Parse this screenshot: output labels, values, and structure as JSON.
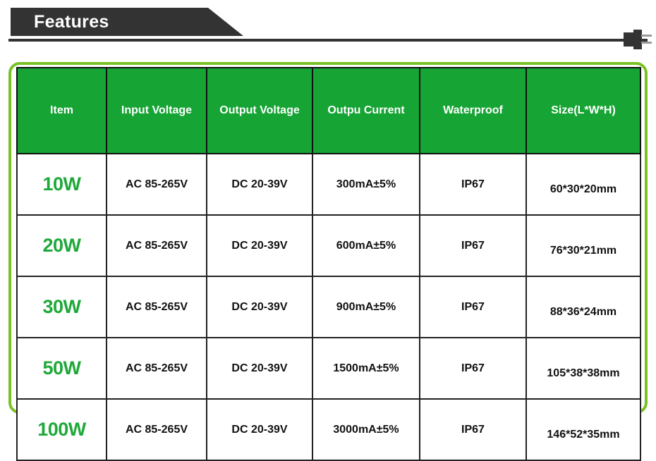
{
  "header": {
    "title": "Features",
    "plug_icon": "power-plug-icon"
  },
  "table": {
    "columns": [
      "Item",
      "Input Voltage",
      "Output Voltage",
      "Outpu Current",
      "Waterproof",
      "Size(L*W*H)"
    ],
    "rows": [
      {
        "item": "10W",
        "input_voltage": "AC 85-265V",
        "output_voltage": "DC 20-39V",
        "output_current": "300mA±5%",
        "waterproof": "IP67",
        "size": "60*30*20mm"
      },
      {
        "item": "20W",
        "input_voltage": "AC 85-265V",
        "output_voltage": "DC 20-39V",
        "output_current": "600mA±5%",
        "waterproof": "IP67",
        "size": "76*30*21mm"
      },
      {
        "item": "30W",
        "input_voltage": "AC 85-265V",
        "output_voltage": "DC 20-39V",
        "output_current": "900mA±5%",
        "waterproof": "IP67",
        "size": "88*36*24mm"
      },
      {
        "item": "50W",
        "input_voltage": "AC 85-265V",
        "output_voltage": "DC 20-39V",
        "output_current": "1500mA±5%",
        "waterproof": "IP67",
        "size": "105*38*38mm"
      },
      {
        "item": "100W",
        "input_voltage": "AC 85-265V",
        "output_voltage": "DC 20-39V",
        "output_current": "3000mA±5%",
        "waterproof": "IP67",
        "size": "146*52*35mm"
      }
    ]
  },
  "colors": {
    "banner_dark": "#333333",
    "header_green": "#16a434",
    "item_green": "#1fa83a",
    "frame_green": "#7ac125",
    "grid_line": "#222222",
    "plug_pin_gray": "#9b9b9b"
  }
}
